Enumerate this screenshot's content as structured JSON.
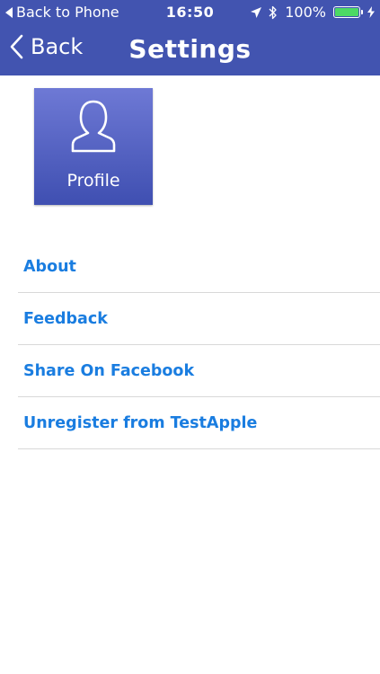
{
  "status_bar": {
    "back_to": "Back to Phone",
    "time": "16:50",
    "battery": "100%",
    "battery_level": 1.0,
    "icons": [
      "back-triangle-icon",
      "location-arrow-icon",
      "bluetooth-icon",
      "battery-icon",
      "charging-bolt-icon"
    ],
    "battery_color": "#4cd964"
  },
  "nav": {
    "back_label": "Back",
    "title": "Settings"
  },
  "profile": {
    "label": "Profile",
    "icon": "person-outline-icon"
  },
  "menu": [
    {
      "label": "About"
    },
    {
      "label": "Feedback"
    },
    {
      "label": "Share On Facebook"
    },
    {
      "label": "Unregister from TestApple"
    }
  ],
  "colors": {
    "header": "#4254b0",
    "link": "#1a7de0",
    "divider": "#d8d8d8"
  }
}
